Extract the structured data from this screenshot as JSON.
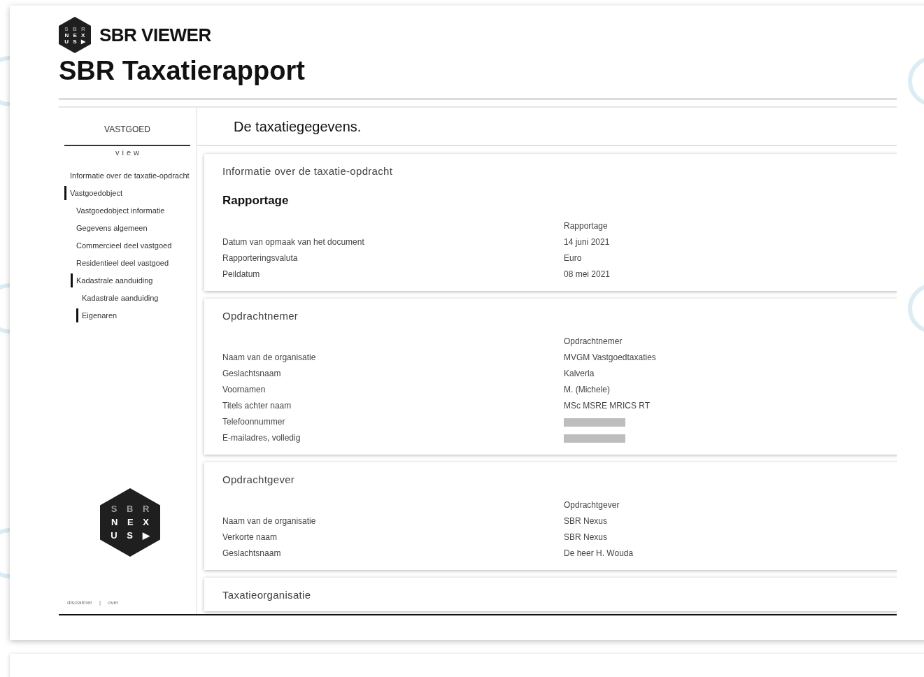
{
  "app": {
    "title": "SBR VIEWER",
    "logo": [
      "S B R",
      "N E X",
      "U S ▶"
    ]
  },
  "page_title": "SBR Taxatierapport",
  "sidebar": {
    "heading": "VASTGOED",
    "subheading": "view",
    "items": [
      {
        "label": "Informatie over de taxatie-opdracht",
        "selected": false
      },
      {
        "label": "Vastgoedobject",
        "selected": true,
        "children": [
          {
            "label": "Vastgoedobject informatie",
            "selected": false
          },
          {
            "label": "Gegevens algemeen",
            "selected": false
          },
          {
            "label": "Commercieel deel vastgoed",
            "selected": false
          },
          {
            "label": "Residentieel deel vastgoed",
            "selected": false
          },
          {
            "label": "Kadastrale aanduiding",
            "selected": true,
            "children": [
              {
                "label": "Kadastrale aanduiding",
                "selected": false
              },
              {
                "label": "Eigenaren",
                "selected": true
              }
            ]
          }
        ]
      }
    ],
    "logo": [
      "S B R",
      "N E X",
      "U S ▶"
    ],
    "footer_links": [
      "disclaimer",
      "over"
    ],
    "footer_separator": "|"
  },
  "main": {
    "heading": "De taxatiegegevens.",
    "sections": [
      {
        "title": "Informatie over de taxatie-opdracht",
        "subtitle": "Rapportage",
        "group_label": "Rapportage",
        "rows": [
          {
            "label": "Datum van opmaak van het document",
            "value": "14 juni 2021",
            "redacted": false
          },
          {
            "label": "Rapporteringsvaluta",
            "value": "Euro",
            "redacted": false
          },
          {
            "label": "Peildatum",
            "value": "08 mei 2021",
            "redacted": false
          }
        ]
      },
      {
        "title": "Opdrachtnemer",
        "group_label": "Opdrachtnemer",
        "rows": [
          {
            "label": "Naam van de organisatie",
            "value": "MVGM Vastgoedtaxaties",
            "redacted": false
          },
          {
            "label": "Geslachtsnaam",
            "value": "Kalverla",
            "redacted": false
          },
          {
            "label": "Voornamen",
            "value": "M. (Michele)",
            "redacted": false
          },
          {
            "label": "Titels achter naam",
            "value": "MSc MSRE MRICS RT",
            "redacted": false
          },
          {
            "label": "Telefoonnummer",
            "redacted": true
          },
          {
            "label": "E-mailadres, volledig",
            "redacted": true
          }
        ]
      },
      {
        "title": "Opdrachtgever",
        "group_label": "Opdrachtgever",
        "rows": [
          {
            "label": "Naam van de organisatie",
            "value": "SBR Nexus",
            "redacted": false
          },
          {
            "label": "Verkorte naam",
            "value": "SBR Nexus",
            "redacted": false
          },
          {
            "label": "Geslachtsnaam",
            "value": "De heer H. Wouda",
            "redacted": false
          }
        ]
      },
      {
        "title": "Taxatieorganisatie"
      }
    ]
  }
}
